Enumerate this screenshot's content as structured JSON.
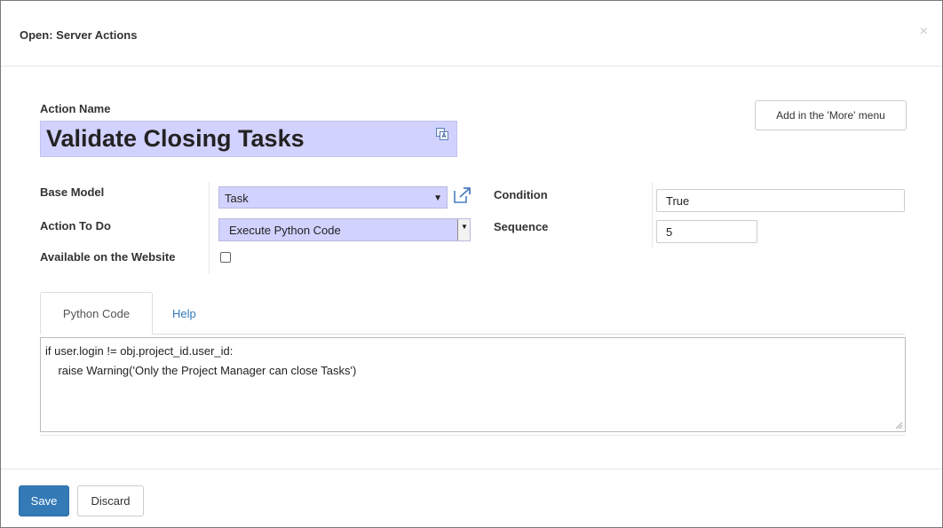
{
  "dialog": {
    "title": "Open: Server Actions",
    "close_glyph": "×"
  },
  "form": {
    "action_name_label": "Action Name",
    "action_name_value": "Validate Closing Tasks",
    "more_menu_button": "Add in the 'More' menu",
    "base_model_label": "Base Model",
    "base_model_value": "Task",
    "action_to_do_label": "Action To Do",
    "action_to_do_value": "Execute Python Code",
    "available_website_label": "Available on the Website",
    "available_website_checked": false,
    "condition_label": "Condition",
    "condition_value": "True",
    "sequence_label": "Sequence",
    "sequence_value": "5"
  },
  "tabs": [
    {
      "label": "Python Code",
      "active": true
    },
    {
      "label": "Help",
      "active": false
    }
  ],
  "code": {
    "lines": [
      "if user.login != obj.project_id.user_id:",
      "    raise Warning('Only the Project Manager can close Tasks')"
    ]
  },
  "footer": {
    "save_label": "Save",
    "discard_label": "Discard"
  },
  "colors": {
    "required_field_bg": "#d2d2ff",
    "primary_button": "#337ab7",
    "link": "#337ab7"
  },
  "icons": {
    "translate": "translate-icon",
    "external_link": "external-link-icon",
    "close": "close-icon",
    "dropdown": "chevron-down-icon"
  }
}
